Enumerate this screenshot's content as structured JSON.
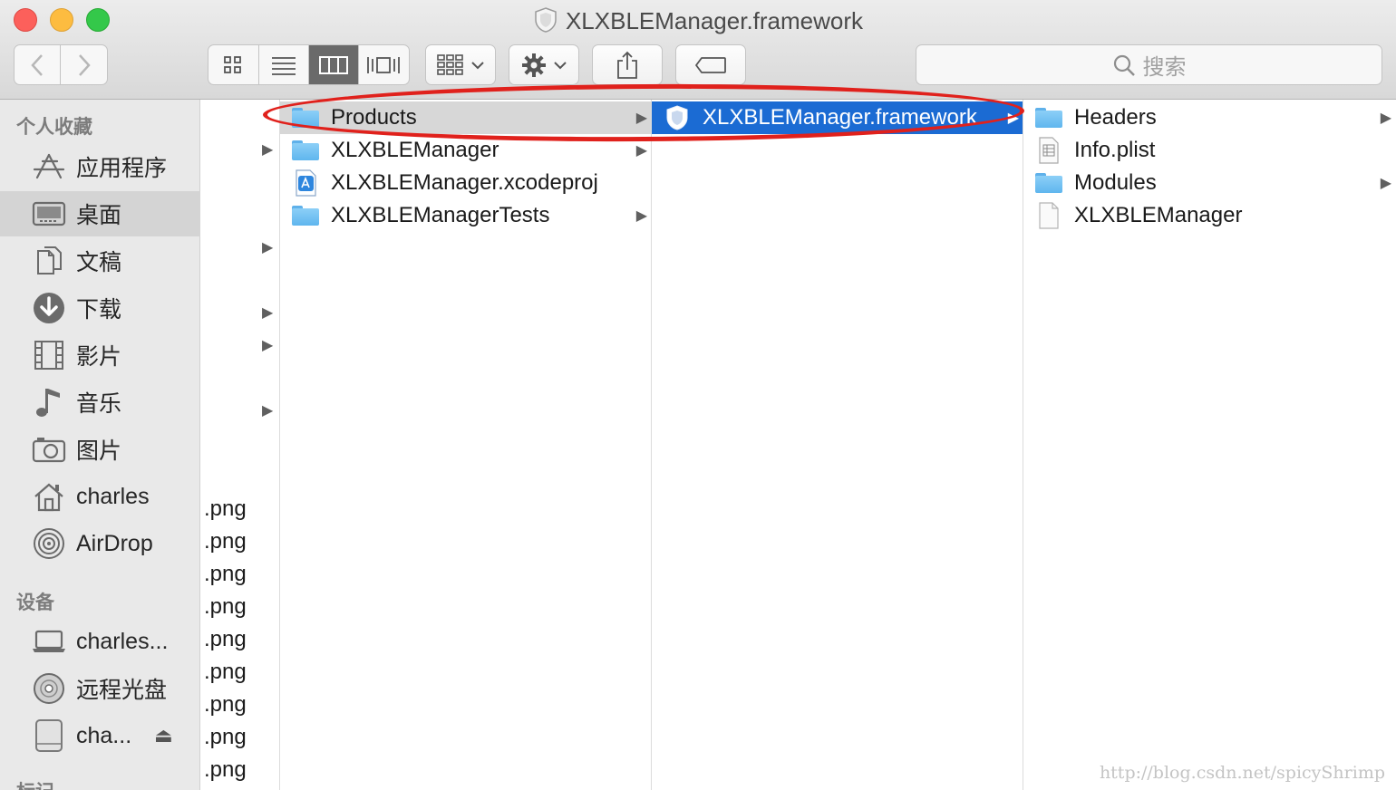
{
  "window": {
    "title": "XLXBLEManager.framework"
  },
  "toolbar": {
    "back_icon": "chevron-left-icon",
    "forward_icon": "chevron-right-icon",
    "view_modes": [
      "icon-view",
      "list-view",
      "column-view",
      "cover-flow-view"
    ],
    "active_view": "column-view",
    "search_placeholder": "搜索"
  },
  "sidebar": {
    "favorites_header": "个人收藏",
    "favorites": [
      {
        "label": "应用程序",
        "icon": "applications-icon"
      },
      {
        "label": "桌面",
        "icon": "desktop-icon",
        "active": true
      },
      {
        "label": "文稿",
        "icon": "documents-icon"
      },
      {
        "label": "下载",
        "icon": "downloads-icon"
      },
      {
        "label": "影片",
        "icon": "movies-icon"
      },
      {
        "label": "音乐",
        "icon": "music-icon"
      },
      {
        "label": "图片",
        "icon": "pictures-icon"
      },
      {
        "label": "charles",
        "icon": "home-icon"
      },
      {
        "label": "AirDrop",
        "icon": "airdrop-icon"
      }
    ],
    "devices_header": "设备",
    "devices": [
      {
        "label": "charles...",
        "icon": "laptop-icon"
      },
      {
        "label": "远程光盘",
        "icon": "disc-icon"
      },
      {
        "label": "cha...",
        "icon": "external-drive-icon",
        "eject": "⏏"
      }
    ],
    "tags_header": "标记"
  },
  "columns": {
    "col0": {
      "png_label": ".png"
    },
    "col1": [
      {
        "label": "Products",
        "icon": "folder-icon",
        "arrow": "▶",
        "selected": "gray"
      },
      {
        "label": "XLXBLEManager",
        "icon": "folder-icon",
        "arrow": "▶"
      },
      {
        "label": "XLXBLEManager.xcodeproj",
        "icon": "xcodeproj-icon"
      },
      {
        "label": "XLXBLEManagerTests",
        "icon": "folder-icon",
        "arrow": "▶"
      }
    ],
    "col2": [
      {
        "label": "XLXBLEManager.framework",
        "icon": "framework-icon",
        "arrow": "▶",
        "selected": "blue"
      }
    ],
    "col3": [
      {
        "label": "Headers",
        "icon": "folder-icon",
        "arrow": "▶"
      },
      {
        "label": "Info.plist",
        "icon": "plist-file-icon"
      },
      {
        "label": "Modules",
        "icon": "folder-icon",
        "arrow": "▶"
      },
      {
        "label": "XLXBLEManager",
        "icon": "blank-file-icon"
      }
    ]
  },
  "watermark": "http://blog.csdn.net/spicyShrimp",
  "colors": {
    "selection_blue": "#1b6bd3",
    "annotation_red": "#e0211c"
  }
}
